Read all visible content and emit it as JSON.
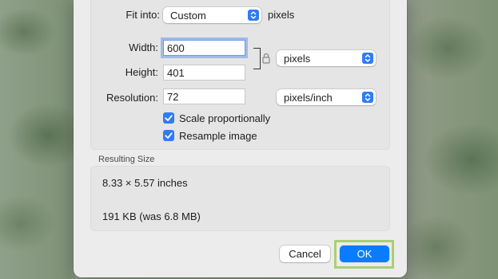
{
  "dialog": {
    "fit_into": {
      "label": "Fit into:",
      "value": "Custom",
      "unit": "pixels"
    },
    "width": {
      "label": "Width:",
      "value": "600"
    },
    "height": {
      "label": "Height:",
      "value": "401"
    },
    "size_unit": "pixels",
    "resolution": {
      "label": "Resolution:",
      "value": "72",
      "unit": "pixels/inch"
    },
    "scale_proportionally": {
      "label": "Scale proportionally",
      "checked": true
    },
    "resample_image": {
      "label": "Resample image",
      "checked": true
    },
    "resulting_size": {
      "title": "Resulting Size",
      "dimensions": "8.33 × 5.57 inches",
      "file_size": "191 KB (was 6.8 MB)"
    },
    "buttons": {
      "cancel": "Cancel",
      "ok": "OK"
    }
  },
  "colors": {
    "accent": "#0a7cff",
    "highlight": "#a9cf74"
  },
  "icons": {
    "stepper": "chevron-up-down-icon",
    "check": "checkmark-icon",
    "lock": "lock-icon"
  }
}
